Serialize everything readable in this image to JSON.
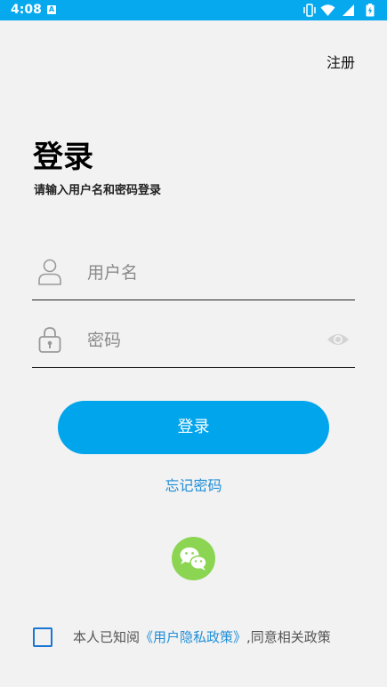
{
  "status_bar": {
    "time": "4:08",
    "notification_icon": "a-icon",
    "indicators": [
      "vibrate-icon",
      "wifi-icon",
      "signal-icon",
      "battery-charging-icon"
    ],
    "color": "#06a8ee"
  },
  "header": {
    "register_label": "注册"
  },
  "login": {
    "title": "登录",
    "subtitle": "请输入用户名和密码登录",
    "username": {
      "placeholder": "用户名",
      "value": "",
      "icon": "user-icon"
    },
    "password": {
      "placeholder": "密码",
      "value": "",
      "icon": "lock-icon",
      "toggle_icon": "eye-icon"
    },
    "submit_label": "登录",
    "forgot_label": "忘记密码",
    "social_icon": "wechat-icon"
  },
  "agreement": {
    "checked": false,
    "prefix": "本人已知阅",
    "policy_link": "《用户隐私政策》",
    "suffix": ",同意相关政策"
  },
  "colors": {
    "accent": "#00a5ec",
    "link": "#1f8fd8",
    "wechat": "#8bd553",
    "checkbox": "#1976d2",
    "background": "#f2f2f2"
  }
}
